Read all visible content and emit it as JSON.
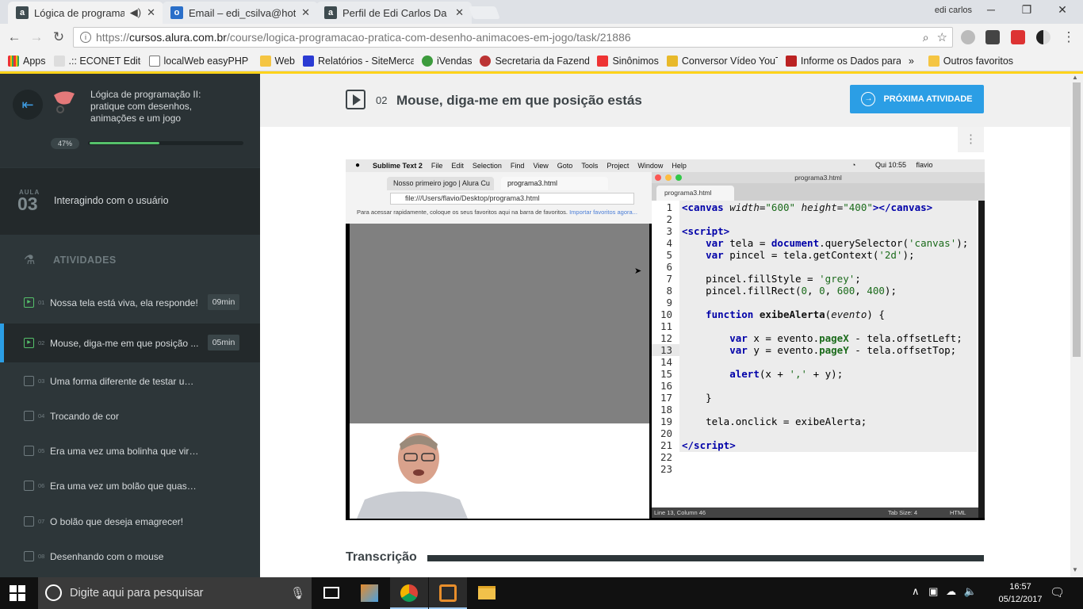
{
  "browser": {
    "tabs": [
      {
        "title": "Lógica de programação",
        "icon": "alura-icon",
        "active": true
      },
      {
        "title": "Email – edi_csilva@hotmail.com",
        "icon": "outlook-icon",
        "active": false
      },
      {
        "title": "Perfil de Edi Carlos Da Silva",
        "icon": "alura-icon",
        "active": false
      }
    ],
    "user": "edi carlos",
    "url_scheme": "https://",
    "url_host": "cursos.alura.com.br",
    "url_path": "/course/logica-programacao-pratica-com-desenho-animacoes-em-jogo/task/21886",
    "bookmarks": [
      "Apps",
      ".:: ECONET Editora ::.",
      "localWeb easyPHP",
      "Web",
      "Relatórios - SiteMercado",
      "iVendas",
      "Secretaria da Fazenda",
      "Sinônimos",
      "Conversor Vídeo YouTube",
      "Informe os Dados para"
    ],
    "bookmarks_more": "»",
    "other_bookmarks": "Outros favoritos"
  },
  "sidebar": {
    "course_title": "Lógica de programação II: pratique com desenhos, animações e um jogo",
    "progress_label": "47%",
    "progress": 0.47,
    "aula_label": "AULA",
    "aula_number": "03",
    "aula_title": "Interagindo com o usuário",
    "activities_label": "ATIVIDADES",
    "items": [
      {
        "num": "01",
        "title": "Nossa tela está viva, ela responde!",
        "duration": "09min",
        "type": "video"
      },
      {
        "num": "02",
        "title": "Mouse, diga-me em que posição ...",
        "duration": "05min",
        "type": "video",
        "current": true
      },
      {
        "num": "03",
        "title": "Uma forma diferente de testar um if",
        "duration": "",
        "type": "book"
      },
      {
        "num": "04",
        "title": "Trocando de cor",
        "duration": "",
        "type": "book"
      },
      {
        "num": "05",
        "title": "Era uma vez uma bolinha que virou u...",
        "duration": "",
        "type": "book"
      },
      {
        "num": "06",
        "title": "Era uma vez um bolão que quase expl...",
        "duration": "",
        "type": "book"
      },
      {
        "num": "07",
        "title": "O bolão que deseja emagrecer!",
        "duration": "",
        "type": "book"
      },
      {
        "num": "08",
        "title": "Desenhando com o mouse",
        "duration": "",
        "type": "book"
      }
    ]
  },
  "main": {
    "task_number": "02",
    "task_title": "Mouse, diga-me em que posição estás",
    "next_button": "PRÓXIMA ATIVIDADE",
    "transcription_label": "Transcrição"
  },
  "video": {
    "mac_menu": [
      "Sublime Text 2",
      "File",
      "Edit",
      "Selection",
      "Find",
      "View",
      "Goto",
      "Tools",
      "Project",
      "Window",
      "Help"
    ],
    "mac_time": "Qui 10:55",
    "mac_user": "flavio",
    "inner_tab1": "Nosso primeiro jogo | Alura Cu",
    "inner_tab2": "programa3.html",
    "inner_url": "file:///Users/flavio/Desktop/programa3.html",
    "inner_bookmarks_text": "Para acessar rapidamente, coloque os seus favoritos aqui na barra de favoritos.",
    "inner_bookmarks_link": "Importar favoritos agora...",
    "sublime_title": "programa3.html",
    "sublime_tab": "programa3.html",
    "status_left": "Line 13, Column 46",
    "status_tab": "Tab Size: 4",
    "status_lang": "HTML",
    "line_numbers": [
      "1",
      "2",
      "3",
      "4",
      "5",
      "6",
      "7",
      "8",
      "9",
      "10",
      "11",
      "12",
      "13",
      "14",
      "15",
      "16",
      "17",
      "18",
      "19",
      "20",
      "21",
      "22",
      "23"
    ]
  },
  "taskbar": {
    "search_placeholder": "Digite aqui para pesquisar",
    "time": "16:57",
    "date": "05/12/2017"
  },
  "colors": {
    "accent": "#2b9ee5",
    "progress": "#55c16a",
    "sidebar": "#2d3639",
    "highlight": "#ffd31a"
  }
}
